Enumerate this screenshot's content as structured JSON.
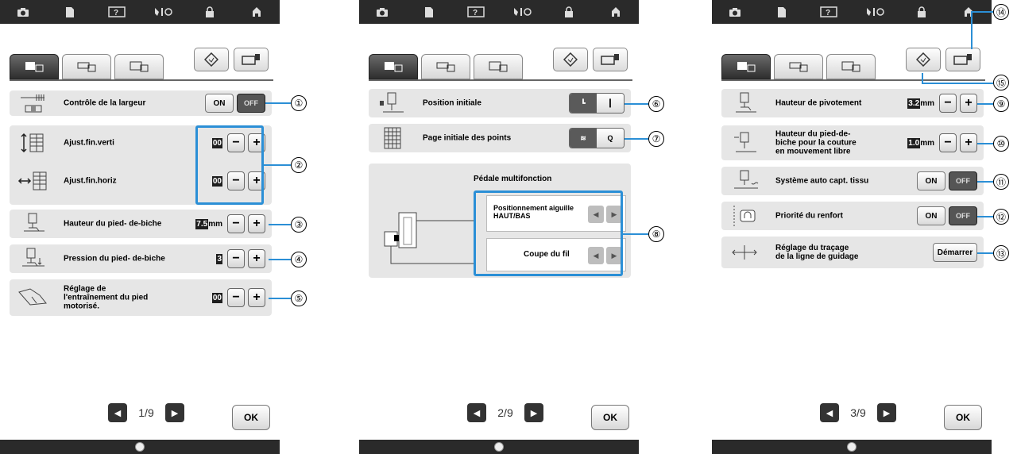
{
  "top_icons": [
    "camera-icon",
    "document-icon",
    "help-icon",
    "tools-icon",
    "lock-icon",
    "home-icon"
  ],
  "screens": [
    {
      "page": "1/9",
      "rows": [
        {
          "label": "Contrôle de la largeur",
          "icon": "width-control-icon",
          "control": "toggle",
          "on": "ON",
          "off": "OFF",
          "callout": "①"
        },
        {
          "label": "Ajust.fin.verti",
          "icon": "vertical-adjust-icon",
          "control": "stepper",
          "value": "00",
          "unit": "",
          "callout": "②"
        },
        {
          "label": "Ajust.fin.horiz",
          "icon": "horizontal-adjust-icon",
          "control": "stepper",
          "value": "00",
          "unit": "",
          "callout": ""
        },
        {
          "label": "Hauteur du pied- de-biche",
          "icon": "presser-foot-height-icon",
          "control": "stepper",
          "value": "7.5",
          "unit": "mm",
          "callout": "③"
        },
        {
          "label": "Pression du pied- de-biche",
          "icon": "presser-foot-pressure-icon",
          "control": "stepper",
          "value": "3",
          "unit": "",
          "callout": "④"
        },
        {
          "label_lines": [
            "Réglage de",
            "l'entraînement du pied",
            "motorisé."
          ],
          "icon": "dual-feed-icon",
          "control": "stepper",
          "value": "00",
          "unit": "",
          "callout": "⑤"
        }
      ]
    },
    {
      "page": "2/9",
      "rows": [
        {
          "label": "Position initiale",
          "icon": "needle-position-icon",
          "callout": "⑥"
        },
        {
          "label": "Page initiale des points",
          "icon": "stitch-grid-icon",
          "callout": "⑦"
        }
      ],
      "pedal": {
        "title": "Pédale multifonction",
        "option1_lines": [
          "Positionnement aiguille",
          "HAUT/BAS"
        ],
        "option2": "Coupe du fil",
        "callout": "⑧"
      }
    },
    {
      "page": "3/9",
      "rows": [
        {
          "label": "Hauteur de pivotement",
          "icon": "pivot-height-icon",
          "control": "stepper",
          "value": "3.2",
          "unit": "mm",
          "callout": "⑨"
        },
        {
          "label_lines": [
            "Hauteur du pied-de-",
            "biche pour la couture",
            "en mouvement libre"
          ],
          "icon": "free-motion-icon",
          "control": "stepper",
          "value": "1.0",
          "unit": "mm",
          "callout": "⑩"
        },
        {
          "label": "Système auto capt. tissu",
          "icon": "fabric-sensor-icon",
          "control": "toggle",
          "on": "ON",
          "off": "OFF",
          "callout": "⑪"
        },
        {
          "label": "Priorité du renfort",
          "icon": "reinforcement-icon",
          "control": "toggle",
          "on": "ON",
          "off": "OFF",
          "callout": "⑫"
        },
        {
          "label_lines": [
            "Réglage du traçage",
            "de la ligne de guidage"
          ],
          "icon": "guideline-icon",
          "control": "button",
          "button": "Démarrer",
          "callout": "⑬"
        }
      ],
      "callout_top": "⑭",
      "callout_mid": "⑮"
    }
  ],
  "ok_label": "OK"
}
